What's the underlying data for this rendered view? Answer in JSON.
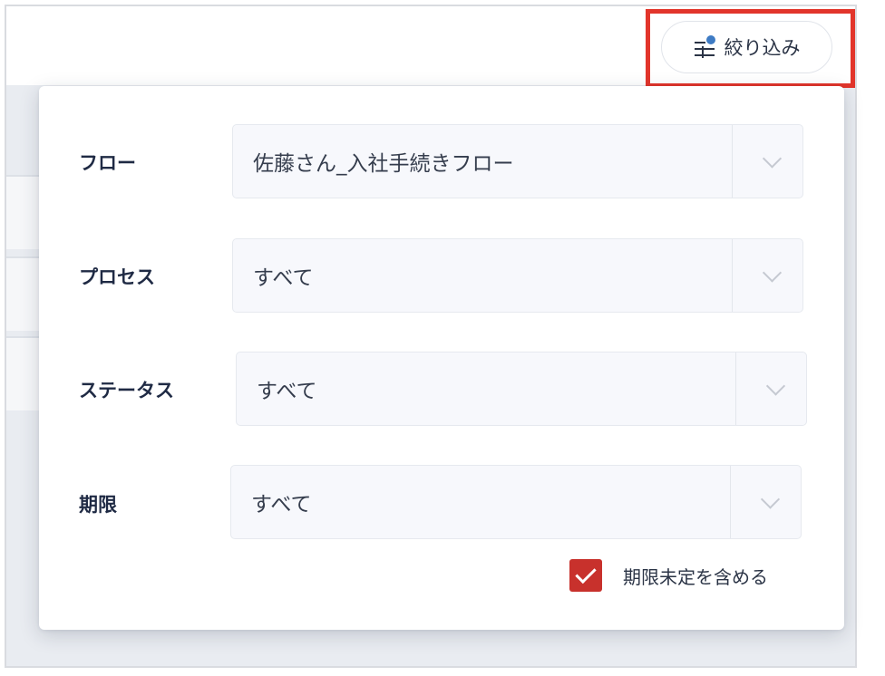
{
  "toolbar": {
    "filter_button_label": "絞り込み"
  },
  "filters": [
    {
      "label": "フロー",
      "value": "佐藤さん_入社手続きフロー"
    },
    {
      "label": "プロセス",
      "value": "すべて"
    },
    {
      "label": "ステータス",
      "value": "すべて"
    },
    {
      "label": "期限",
      "value": "すべて"
    }
  ],
  "include_no_deadline": {
    "label": "期限未定を含める",
    "checked": true
  },
  "colors": {
    "highlight": "#e2352b",
    "checkbox": "#c8312c",
    "badge_dot": "#3e7bc4",
    "label_text": "#1f2a44"
  },
  "icons": {
    "filter": "sliders-icon",
    "select": "chevron-down-icon",
    "check": "checkmark-icon"
  }
}
